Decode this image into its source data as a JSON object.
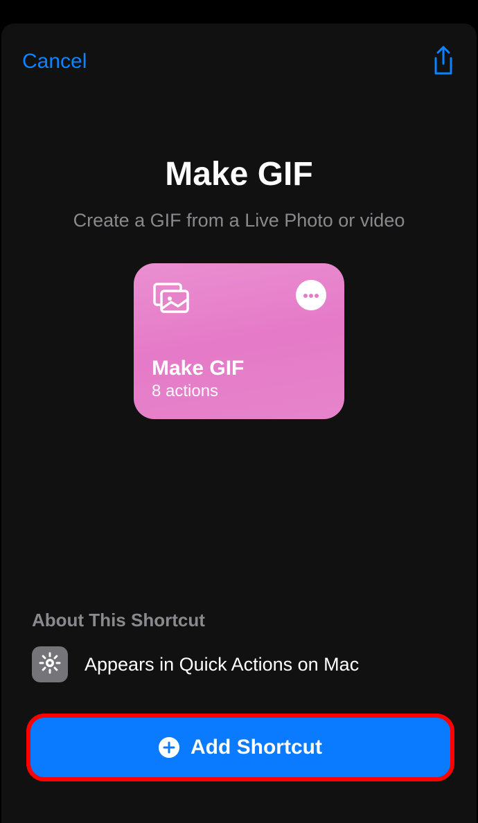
{
  "header": {
    "cancel_label": "Cancel"
  },
  "hero": {
    "title": "Make GIF",
    "subtitle": "Create a GIF from a Live Photo or video"
  },
  "card": {
    "name": "Make GIF",
    "actions_label": "8 actions",
    "accent_gradient_start": "#ea8fd0",
    "accent_gradient_end": "#e57ac8"
  },
  "about": {
    "header": "About This Shortcut",
    "items": [
      {
        "label": "Appears in Quick Actions on Mac"
      }
    ]
  },
  "cta": {
    "label": "Add Shortcut"
  },
  "colors": {
    "link": "#0a84ff",
    "primary_button": "#0a7aff",
    "highlight_ring": "#ff0000"
  }
}
